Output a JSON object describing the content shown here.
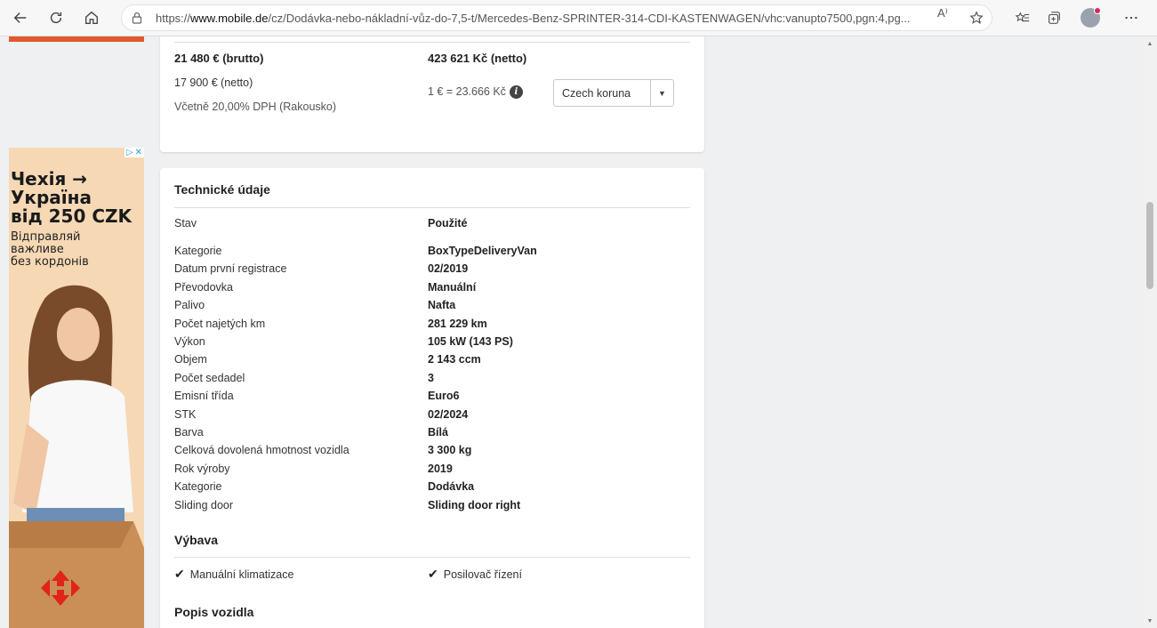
{
  "browser": {
    "url_prefix": "https://",
    "url_domain": "www.mobile.de",
    "url_path": "/cz/Dodávka-nebo-nákladní-vůz-do-7,5-t/Mercedes-Benz-SPRINTER-314-CDI-KASTENWAGEN/vhc:vanupto7500,pgn:4,pg...",
    "read_aloud_label": "A⁾"
  },
  "price": {
    "brutto_eur": "21 480 € (brutto)",
    "netto_eur": "17 900 € (netto)",
    "vat_note": "Včetně 20,00% DPH (Rakousko)",
    "netto_czk": "423 621 Kč (netto)",
    "exchange_rate": "1 € = 23.666 Kč",
    "currency_selected": "Czech koruna"
  },
  "tech": {
    "title": "Technické údaje",
    "rows": [
      {
        "label": "Stav",
        "value": "Použité"
      },
      {
        "label": "Kategorie",
        "value": "BoxTypeDeliveryVan"
      },
      {
        "label": "Datum první registrace",
        "value": "02/2019"
      },
      {
        "label": "Převodovka",
        "value": "Manuální"
      },
      {
        "label": "Palivo",
        "value": "Nafta"
      },
      {
        "label": "Počet najetých km",
        "value": "281 229 km"
      },
      {
        "label": "Výkon",
        "value": "105 kW (143 PS)"
      },
      {
        "label": "Objem",
        "value": "2 143 ccm"
      },
      {
        "label": "Počet sedadel",
        "value": "3"
      },
      {
        "label": "Emisní třída",
        "value": "Euro6"
      },
      {
        "label": "STK",
        "value": "02/2024"
      },
      {
        "label": "Barva",
        "value": "Bílá"
      },
      {
        "label": "Celková dovolená hmotnost vozidla",
        "value": "3 300 kg"
      },
      {
        "label": "Rok výroby",
        "value": "2019"
      },
      {
        "label": "Kategorie",
        "value": "Dodávka"
      },
      {
        "label": "Sliding door",
        "value": "Sliding door right"
      }
    ]
  },
  "equipment": {
    "title": "Výbava",
    "items": [
      "Manuální klimatizace",
      "Posilovač řízení"
    ]
  },
  "description": {
    "title": "Popis vozidla"
  },
  "ad": {
    "headline_1": "Чехія →",
    "headline_2": "Україна",
    "headline_3": "від 250 CZK",
    "sub_1": "Відправляй",
    "sub_2": "важливе",
    "sub_3": "без кордонів"
  },
  "colors": {
    "ad_background": "#f6d8b5",
    "ad_logo_red": "#e2231a",
    "top_strip": "#e05a2b"
  },
  "icons": [
    "back-arrow-icon",
    "refresh-icon",
    "home-icon",
    "lock-icon",
    "read-aloud-icon",
    "favorite-add-icon",
    "favorites-icon",
    "collections-icon",
    "profile-avatar",
    "more-icon",
    "info-icon",
    "check-icon",
    "adchoices-icon",
    "close-icon"
  ]
}
